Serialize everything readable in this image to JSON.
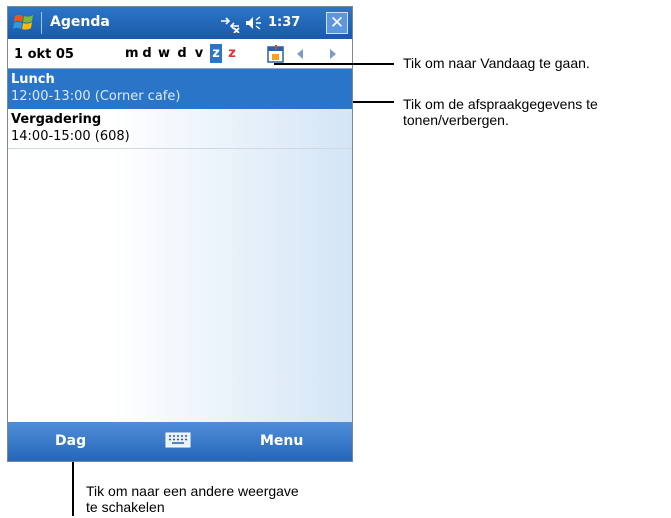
{
  "titlebar": {
    "title": "Agenda",
    "time": "1:37",
    "close_label": "✕"
  },
  "datebar": {
    "date": "1  okt 05",
    "weekdays": [
      {
        "label": "m",
        "state": "normal"
      },
      {
        "label": "d",
        "state": "normal"
      },
      {
        "label": "w",
        "state": "normal"
      },
      {
        "label": "d",
        "state": "normal"
      },
      {
        "label": "v",
        "state": "normal"
      },
      {
        "label": "z",
        "state": "selected"
      },
      {
        "label": "z",
        "state": "weekend"
      }
    ]
  },
  "appointments": [
    {
      "name": "Lunch",
      "time": "12:00-13:00 (Corner cafe)",
      "selected": true
    },
    {
      "name": "Vergadering",
      "time": "14:00-15:00 (608)",
      "selected": false
    }
  ],
  "menubar": {
    "left": "Dag",
    "right": "Menu"
  },
  "callouts": {
    "today": "Tik om naar Vandaag te gaan.",
    "details_line1": "Tik om de afspraakgegevens te",
    "details_line2": "tonen/verbergen.",
    "view_line1": "Tik om naar een andere weergave",
    "view_line2": "te schakelen"
  },
  "colors": {
    "accent": "#2b75c8",
    "weekend": "#e03030"
  }
}
